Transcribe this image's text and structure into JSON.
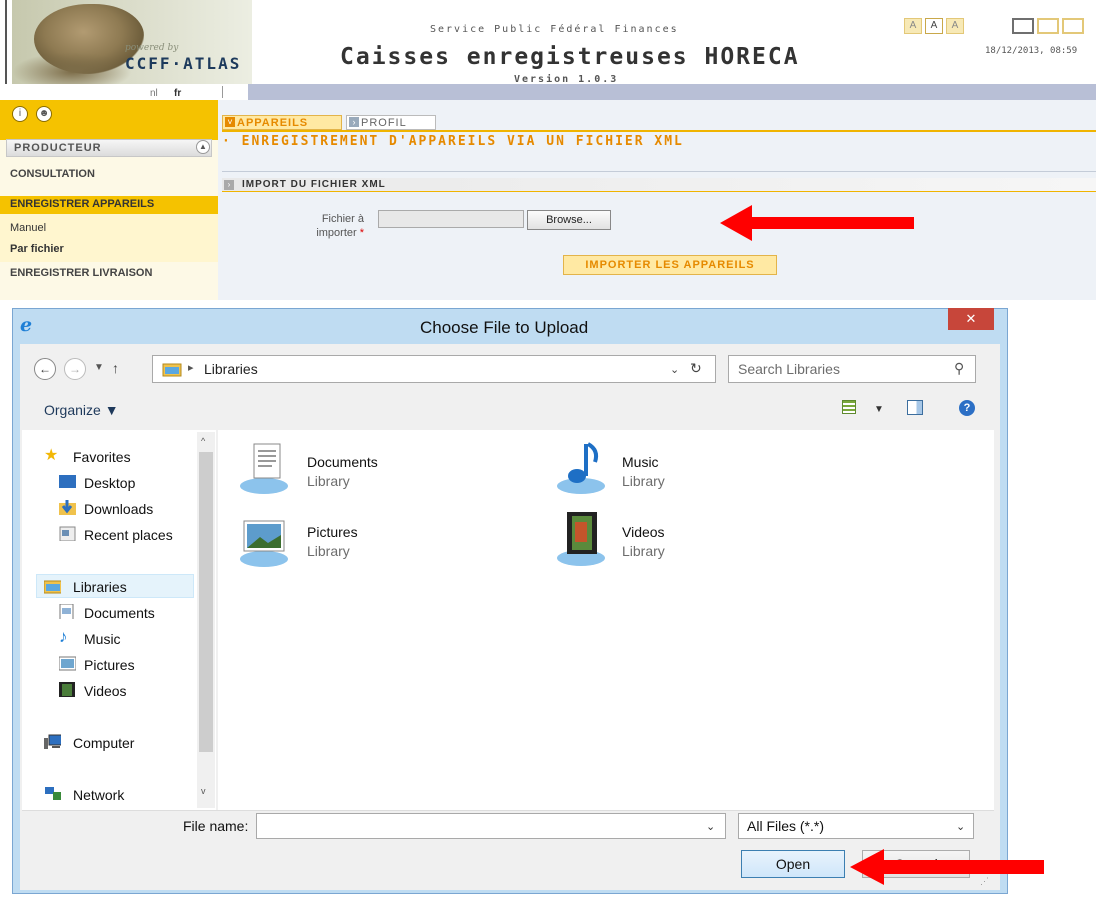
{
  "app": {
    "powered_by": "powered by",
    "logo_text": "CCFF·ATLAS",
    "service": "Service Public Fédéral Finances",
    "title": "Caisses enregistreuses HORECA",
    "version": "Version 1.0.3",
    "datetime": "18/12/2013, 08:59",
    "font_sizes": [
      "A",
      "A",
      "A"
    ],
    "lang": {
      "nl": "nl",
      "fr": "fr"
    }
  },
  "sidebar": {
    "profile_section": "PRODUCTEUR",
    "items": {
      "consultation": "CONSULTATION",
      "enregistrer_appareils": "ENREGISTRER APPAREILS",
      "manuel": "Manuel",
      "par_fichier": "Par fichier",
      "enregistrer_livraison": "ENREGISTRER LIVRAISON"
    }
  },
  "main": {
    "tabs": [
      "APPAREILS",
      "PROFIL"
    ],
    "section_title": "· ENREGISTREMENT D'APPAREILS VIA UN FICHIER XML",
    "import_header": "IMPORT DU FICHIER XML",
    "file_label": "Fichier à importer",
    "required_mark": "*",
    "browse_label": "Browse...",
    "import_button": "IMPORTER LES APPAREILS"
  },
  "dialog": {
    "title": "Choose File to Upload",
    "address": "Libraries",
    "search_placeholder": "Search Libraries",
    "organize": "Organize ▼",
    "nav": {
      "favorites": "Favorites",
      "desktop": "Desktop",
      "downloads": "Downloads",
      "recent": "Recent places",
      "libraries": "Libraries",
      "documents": "Documents",
      "music": "Music",
      "pictures": "Pictures",
      "videos": "Videos",
      "computer": "Computer",
      "network": "Network"
    },
    "libraries": [
      {
        "name": "Documents",
        "sub": "Library"
      },
      {
        "name": "Music",
        "sub": "Library"
      },
      {
        "name": "Pictures",
        "sub": "Library"
      },
      {
        "name": "Videos",
        "sub": "Library"
      }
    ],
    "file_name_label": "File name:",
    "file_name_value": "",
    "file_type": "All Files (*.*)",
    "open_label": "Open",
    "cancel_label": "Cancel"
  },
  "colors": {
    "accent": "#f5c200",
    "orange": "#e68a00",
    "arrow": "#ff0000"
  }
}
